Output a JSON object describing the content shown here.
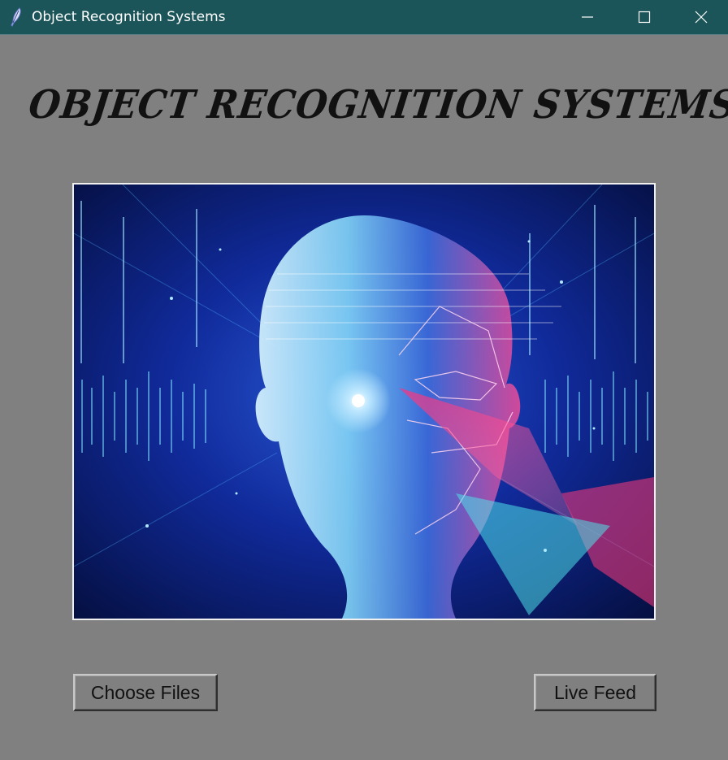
{
  "window": {
    "title": "Object Recognition Systems",
    "icon": "feather-icon",
    "controls": [
      "minimize-icon",
      "maximize-icon",
      "close-icon"
    ],
    "titlebar_color": "#1c5559",
    "background_color": "#808080"
  },
  "main": {
    "heading": "OBJECT RECOGNITION SYSTEMS",
    "image": "ai-face-hologram-image"
  },
  "buttons": {
    "choose_files": "Choose Files",
    "live_feed": "Live Feed"
  }
}
